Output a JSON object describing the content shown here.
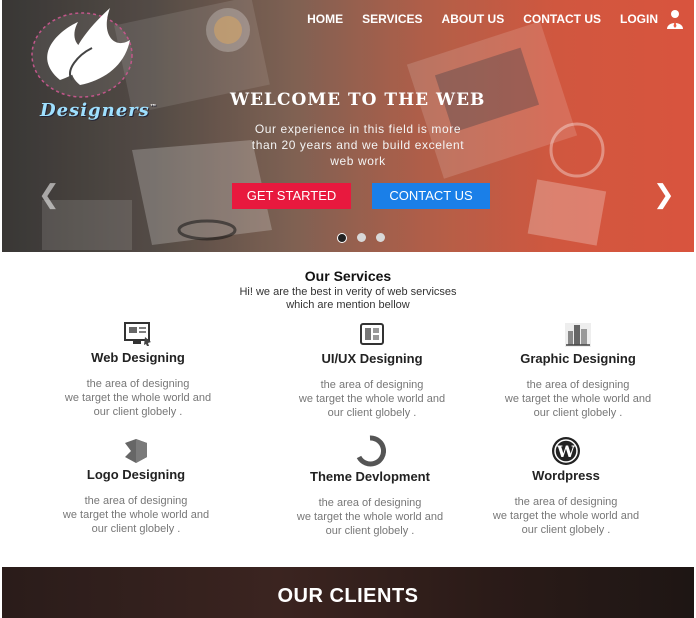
{
  "logo": {
    "brand": "Designers",
    "mark": "™"
  },
  "nav": {
    "items": [
      "HOME",
      "SERVICES",
      "ABOUT US",
      "CONTACT US",
      "LOGIN"
    ]
  },
  "hero": {
    "title": "WELCOME TO THE WEB",
    "text": "Our experience in this field is more than 20 years and we build excelent web work",
    "get_started": "GET STARTED",
    "contact_us": "CONTACT US",
    "slide_count": 3,
    "active_slide": 1
  },
  "services": {
    "title": "Our Services",
    "subtitle_line1": "Hi! we are the  best in verity of web servicses",
    "subtitle_line2": "which are mention bellow",
    "items": [
      {
        "name": "Web Designing",
        "icon": "monitor-icon",
        "desc": "the area of designing\nwe target the whole world  and\nour client globely ."
      },
      {
        "name": "UI/UX Designing",
        "icon": "device-icon",
        "desc": "the area of designing\nwe target the whole world  and\nour client globely ."
      },
      {
        "name": "Graphic Designing",
        "icon": "buildings-icon",
        "desc": "the area of designing\nwe target the whole world  and\nour client globely ."
      },
      {
        "name": "Logo Designing",
        "icon": "cube-icon",
        "desc": "the area of designing\nwe target the whole world  and\nour client globely ."
      },
      {
        "name": "Theme Devlopment",
        "icon": "ring-icon",
        "desc": "the area of designing\nwe target the whole world  and\nour client globely ."
      },
      {
        "name": "Wordpress",
        "icon": "wordpress-icon",
        "desc": "the area of designing\nwe target the whole world  and\nour client globely ."
      }
    ]
  },
  "clients": {
    "title": "OUR CLIENTS"
  },
  "colors": {
    "get_started": "#e8193e",
    "contact": "#1a7fe8",
    "hero_orange": "#ec5c44"
  }
}
